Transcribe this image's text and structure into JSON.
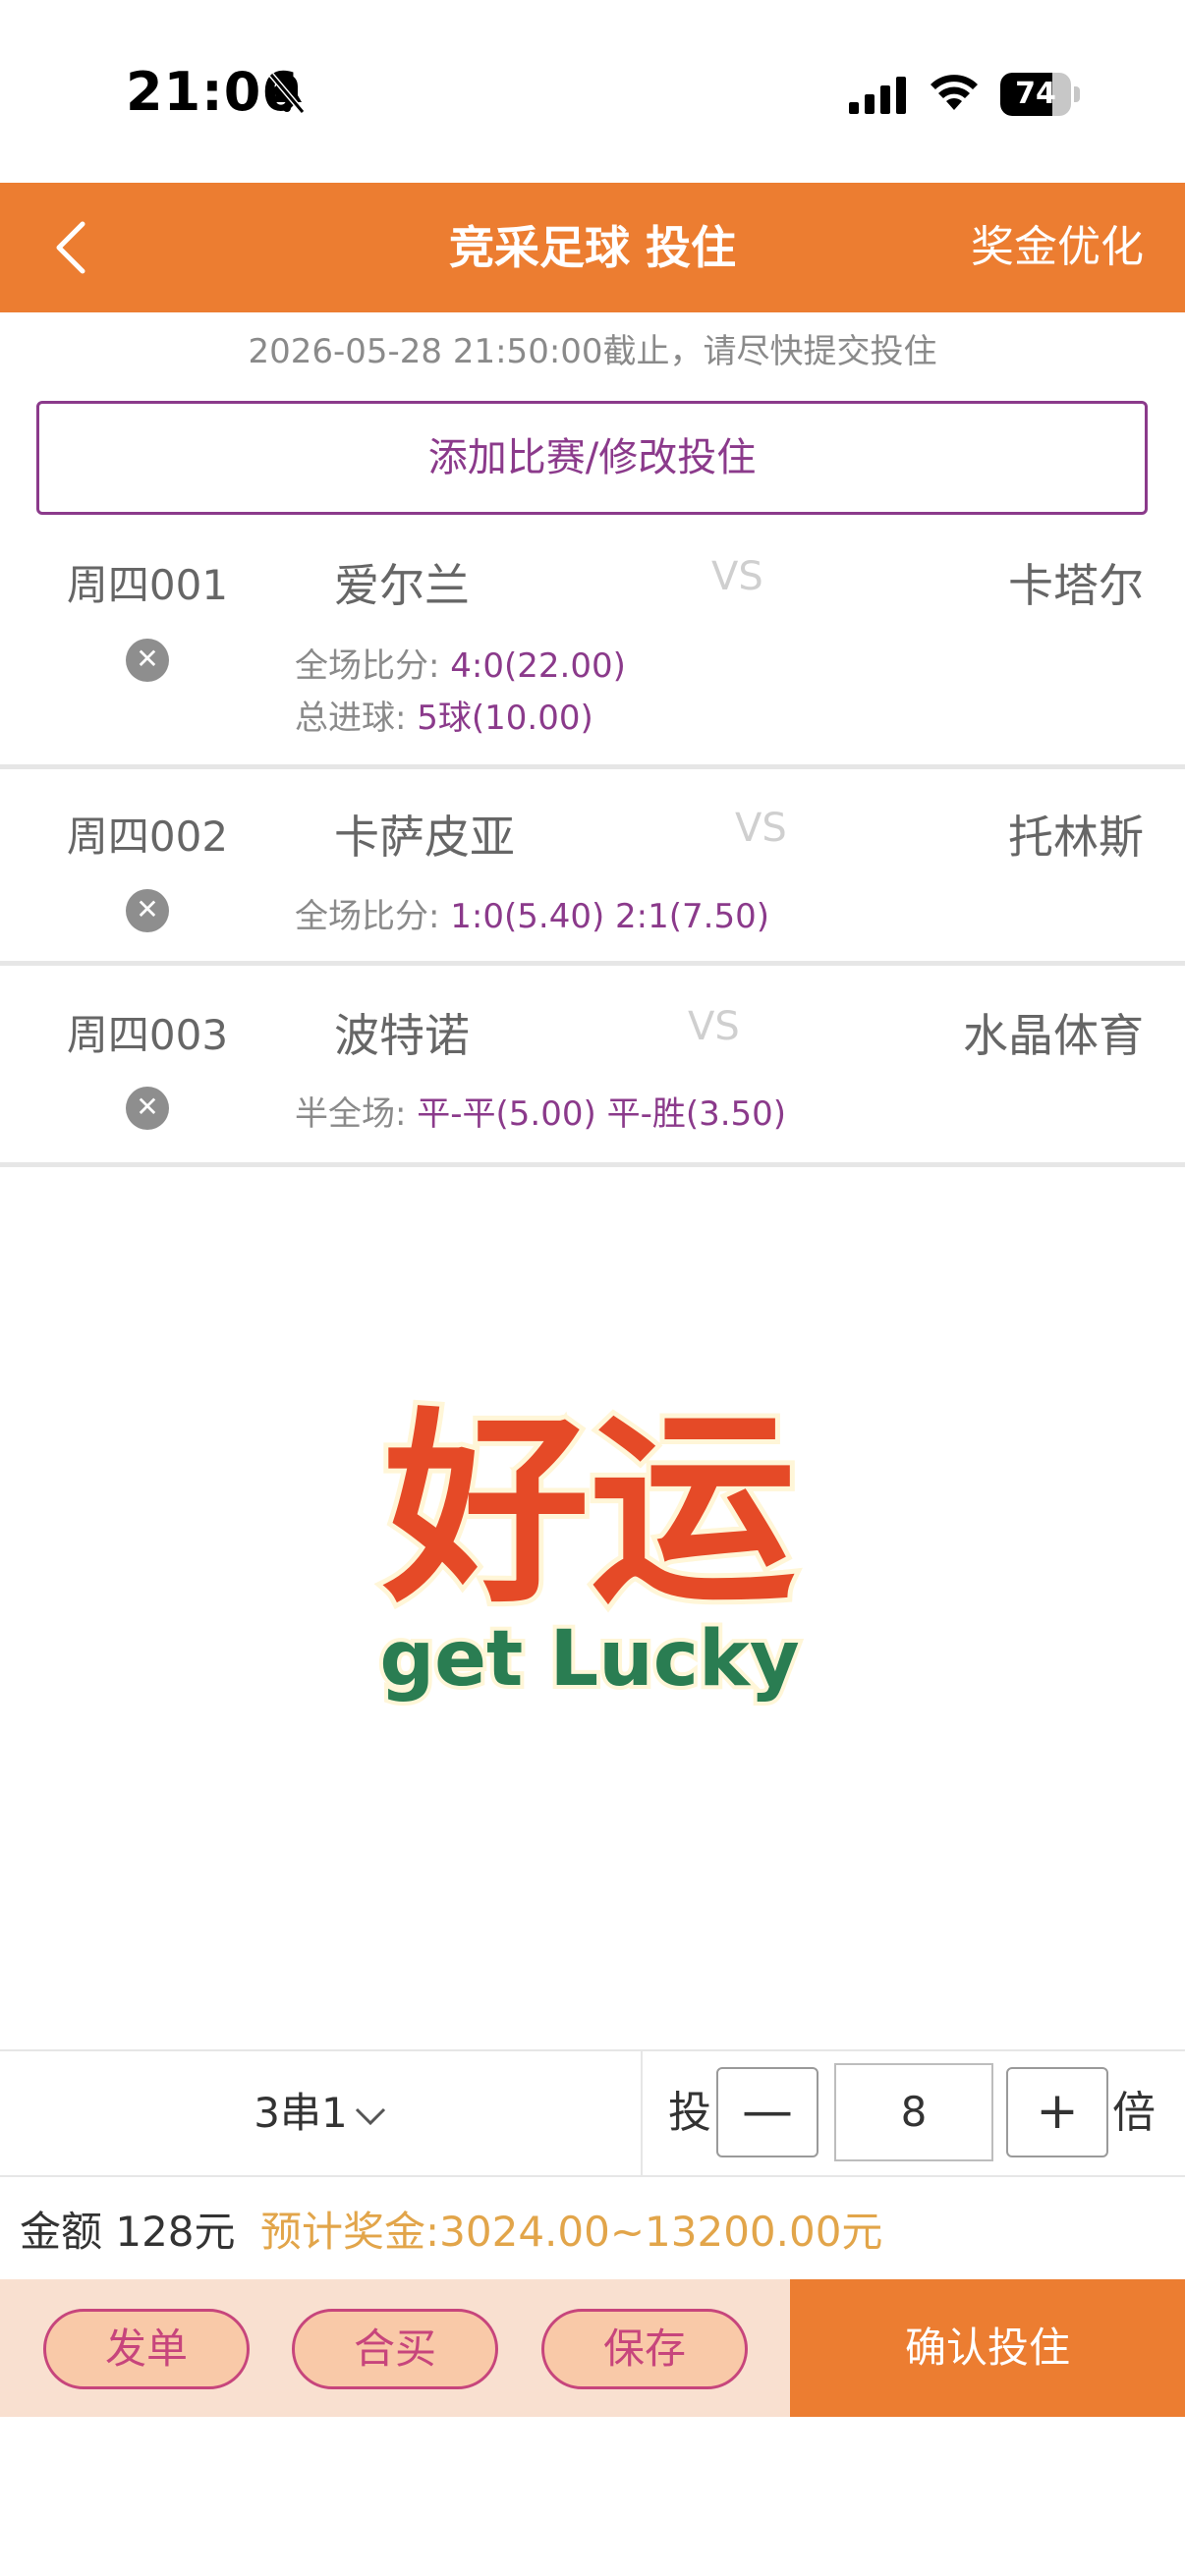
{
  "status": {
    "time": "21:06",
    "battery": "74",
    "battery_level": 0.74
  },
  "header": {
    "title": "竞采足球 投住",
    "right_action": "奖金优化"
  },
  "deadline": "2026-05-28 21:50:00截止，请尽快提交投住",
  "add_button": "添加比赛/修改投住",
  "vs": "VS",
  "matches": [
    {
      "code": "周四001",
      "home": "爱尔兰",
      "away": "卡塔尔",
      "picks": [
        {
          "label": "全场比分: ",
          "value": "4:0(22.00)"
        },
        {
          "label": "总进球: ",
          "value": "5球(10.00)"
        }
      ]
    },
    {
      "code": "周四002",
      "home": "卡萨皮亚",
      "away": "托林斯",
      "picks": [
        {
          "label": "全场比分: ",
          "value": "1:0(5.40) 2:1(7.50)"
        }
      ]
    },
    {
      "code": "周四003",
      "home": "波特诺",
      "away": "水晶体育",
      "picks": [
        {
          "label": "半全场: ",
          "value": "平-平(5.00) 平-胜(3.50)"
        }
      ]
    }
  ],
  "sticker": {
    "top_text": "好运",
    "bottom_text": "get Lucky"
  },
  "bet": {
    "pass_type": "3串1",
    "tou": "投",
    "minus": "—",
    "multiplier": "8",
    "plus": "+",
    "bei": "倍"
  },
  "summary": {
    "amount": "金额 128元",
    "prize": "预计奖金:3024.00~13200.00元"
  },
  "actions": {
    "send": "发单",
    "group_buy": "合买",
    "save": "保存",
    "confirm": "确认投住"
  },
  "colors": {
    "accent": "#ec7d31",
    "purple": "#8b3a8b",
    "prize": "#e2a54a"
  }
}
